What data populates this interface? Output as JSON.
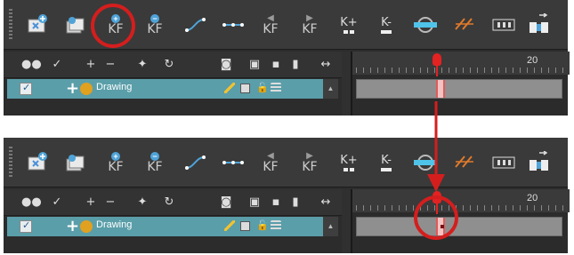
{
  "toolbar": {
    "buttons": [
      {
        "name": "create-drawing-icon"
      },
      {
        "name": "create-drawing-copy-icon"
      },
      {
        "name": "add-keyframe",
        "label": "KF",
        "badge": "+"
      },
      {
        "name": "delete-keyframe",
        "label": "KF",
        "badge": "−"
      },
      {
        "name": "set-ease-icon"
      },
      {
        "name": "set-constant-icon"
      },
      {
        "name": "previous-keyframe",
        "label": "KF",
        "arrow": "◀"
      },
      {
        "name": "next-keyframe",
        "label": "KF",
        "arrow": "▶"
      },
      {
        "name": "add-keyframe-plus",
        "label": "K+"
      },
      {
        "name": "remove-keyframe-minus",
        "label": "K-"
      },
      {
        "name": "onion-skin-icon"
      },
      {
        "name": "motion-path-icon"
      },
      {
        "name": "frames-toggle-icon"
      },
      {
        "name": "expand-icon"
      }
    ]
  },
  "layers": {
    "drawing_label": "Drawing"
  },
  "timeline": {
    "frame_marker": "20"
  },
  "colors": {
    "accent": "#5a9ea9",
    "highlight": "#d41e1e",
    "playhead": "#e32222"
  }
}
